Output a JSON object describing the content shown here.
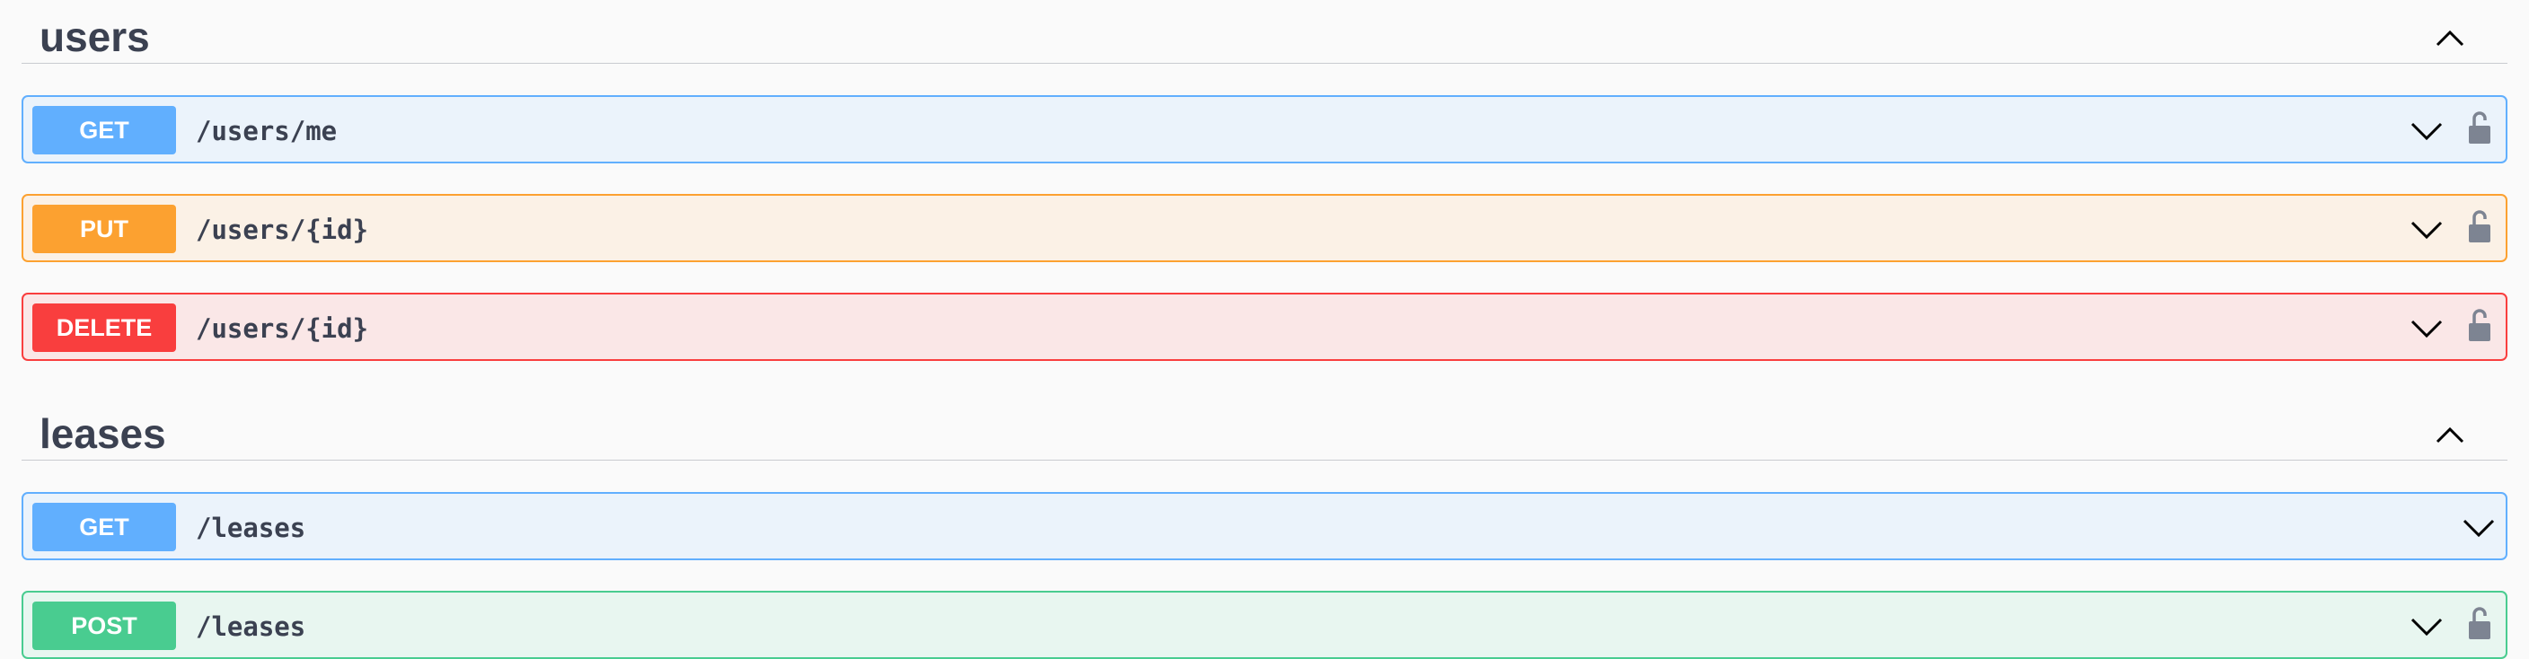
{
  "sections": [
    {
      "title": "users",
      "operations": [
        {
          "method": "GET",
          "path": "/users/me"
        },
        {
          "method": "PUT",
          "path": "/users/{id}"
        },
        {
          "method": "DELETE",
          "path": "/users/{id}"
        }
      ]
    },
    {
      "title": "leases",
      "operations": [
        {
          "method": "GET",
          "path": "/leases"
        },
        {
          "method": "POST",
          "path": "/leases"
        }
      ]
    }
  ],
  "icons": {
    "collapse": "chevron-up-icon",
    "expand": "chevron-down-icon",
    "auth": "lock-icon"
  },
  "colors": {
    "get": "#61affe",
    "put": "#fca130",
    "delete": "#f93e3e",
    "post": "#49cc90",
    "text": "#3b4151"
  }
}
